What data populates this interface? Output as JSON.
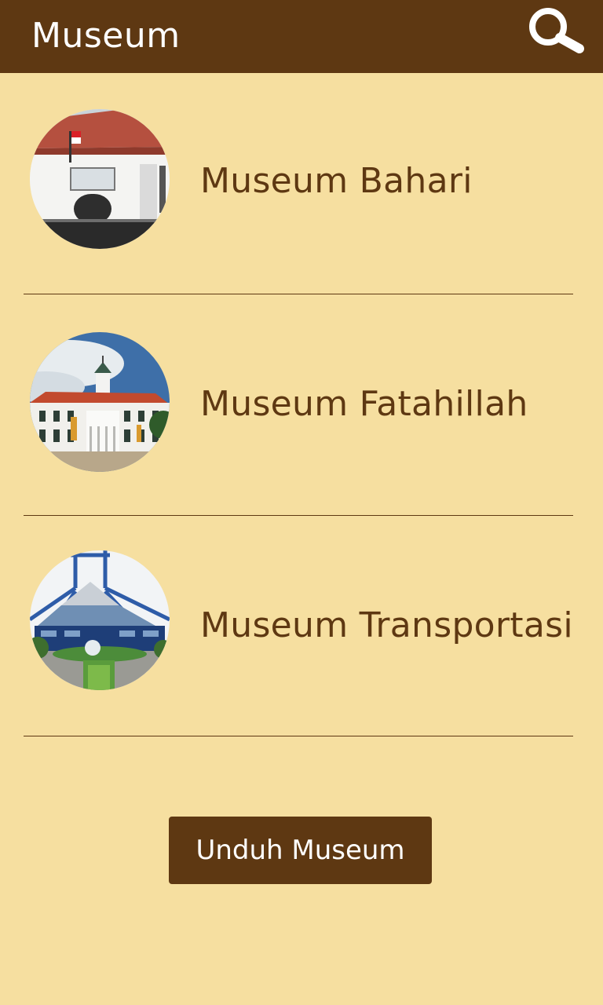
{
  "app_bar": {
    "title": "Museum",
    "search_icon": "search-icon",
    "background_color": "#5E3812"
  },
  "museums": [
    {
      "name": "Museum Bahari",
      "thumbnail": "museum-bahari-photo"
    },
    {
      "name": "Museum Fatahillah",
      "thumbnail": "museum-fatahillah-photo"
    },
    {
      "name": "Museum Transportasi",
      "thumbnail": "museum-transportasi-photo"
    }
  ],
  "download_button": {
    "label": "Unduh Museum"
  },
  "colors": {
    "background": "#F6DFA0",
    "accent": "#5E3812",
    "text_on_accent": "#FFFFFF"
  }
}
